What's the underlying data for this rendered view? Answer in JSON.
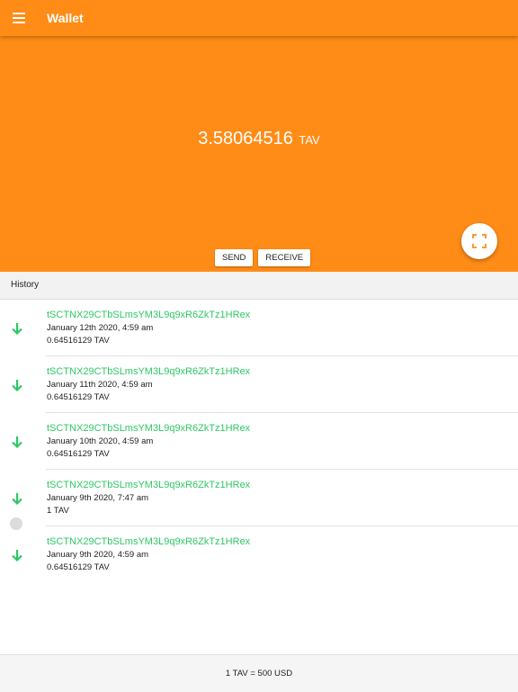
{
  "app": {
    "title": "Wallet"
  },
  "balance": {
    "amount": "3.58064516",
    "unit": "TAV"
  },
  "actions": {
    "send": "SEND",
    "receive": "RECEIVE"
  },
  "history": {
    "title": "History",
    "items": [
      {
        "address": "tSCTNX29CTbSLmsYM3L9q9xR6ZkTz1HRex",
        "date": "January 12th 2020, 4:59 am",
        "amount": "0.64516129 TAV"
      },
      {
        "address": "tSCTNX29CTbSLmsYM3L9q9xR6ZkTz1HRex",
        "date": "January 11th 2020, 4:59 am",
        "amount": "0.64516129 TAV"
      },
      {
        "address": "tSCTNX29CTbSLmsYM3L9q9xR6ZkTz1HRex",
        "date": "January 10th 2020, 4:59 am",
        "amount": "0.64516129 TAV"
      },
      {
        "address": "tSCTNX29CTbSLmsYM3L9q9xR6ZkTz1HRex",
        "date": "January 9th 2020, 7:47 am",
        "amount": "1 TAV"
      },
      {
        "address": "tSCTNX29CTbSLmsYM3L9q9xR6ZkTz1HRex",
        "date": "January 9th 2020, 4:59 am",
        "amount": "0.64516129 TAV"
      }
    ]
  },
  "footer": {
    "rate": "1 TAV = 500 USD"
  },
  "colors": {
    "primary": "#ff8c17",
    "incoming": "#2ec865"
  }
}
